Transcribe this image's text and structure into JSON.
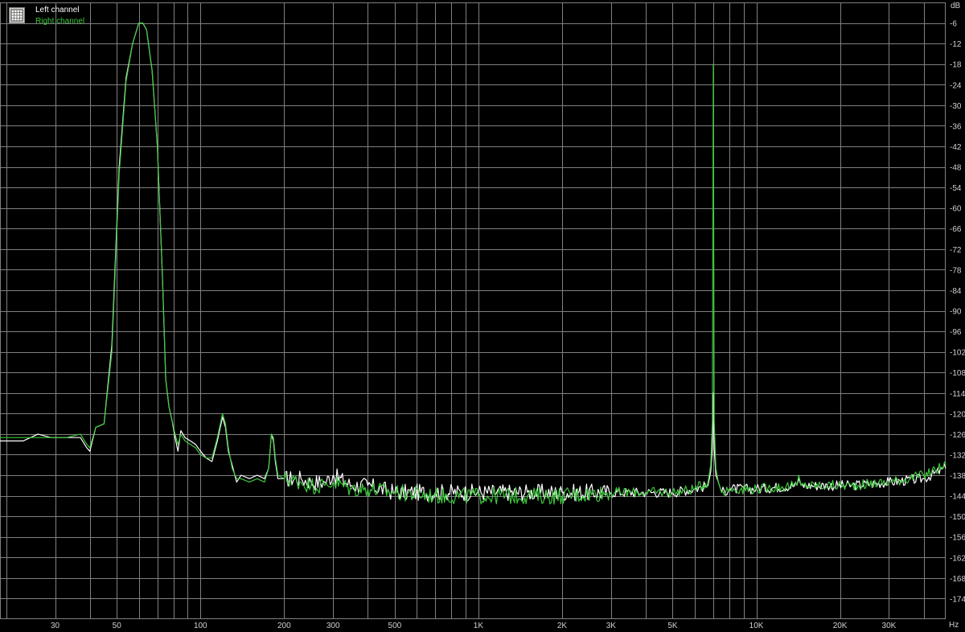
{
  "chart_data": {
    "type": "line",
    "xscale": "log",
    "x_unit": "Hz",
    "y_unit": "dB",
    "xlim": [
      19,
      48000
    ],
    "ylim": [
      -180,
      0
    ],
    "grid": true,
    "background": "#000000",
    "grid_color": "#808080",
    "legend_position": "top-left",
    "x_tick_labels": [
      {
        "value": 30,
        "label": "30"
      },
      {
        "value": 50,
        "label": "50"
      },
      {
        "value": 100,
        "label": "100"
      },
      {
        "value": 200,
        "label": "200"
      },
      {
        "value": 300,
        "label": "300"
      },
      {
        "value": 500,
        "label": "500"
      },
      {
        "value": 1000,
        "label": "1K"
      },
      {
        "value": 2000,
        "label": "2K"
      },
      {
        "value": 3000,
        "label": "3K"
      },
      {
        "value": 5000,
        "label": "5K"
      },
      {
        "value": 10000,
        "label": "10K"
      },
      {
        "value": 20000,
        "label": "20K"
      },
      {
        "value": 30000,
        "label": "30K"
      }
    ],
    "y_ticks": [
      -6,
      -12,
      -18,
      -24,
      -30,
      -36,
      -42,
      -48,
      -54,
      -60,
      -66,
      -72,
      -78,
      -84,
      -90,
      -96,
      -102,
      -108,
      -114,
      -120,
      -126,
      -132,
      -138,
      -144,
      -150,
      -156,
      -162,
      -168,
      -174
    ],
    "series": [
      {
        "name": "Left channel",
        "color": "#ffffff",
        "points": [
          [
            19,
            -128
          ],
          [
            23,
            -128
          ],
          [
            26,
            -126
          ],
          [
            29,
            -127
          ],
          [
            33,
            -127
          ],
          [
            37,
            -127
          ],
          [
            39,
            -130
          ],
          [
            40,
            -131
          ],
          [
            42,
            -124
          ],
          [
            45,
            -123
          ],
          [
            48,
            -100
          ],
          [
            51,
            -48
          ],
          [
            54,
            -22
          ],
          [
            57,
            -12
          ],
          [
            60,
            -6
          ],
          [
            62,
            -6
          ],
          [
            64,
            -8
          ],
          [
            67,
            -20
          ],
          [
            70,
            -42
          ],
          [
            73,
            -80
          ],
          [
            75,
            -110
          ],
          [
            77,
            -118
          ],
          [
            79,
            -122
          ],
          [
            81,
            -127
          ],
          [
            83,
            -131
          ],
          [
            85,
            -125
          ],
          [
            88,
            -127
          ],
          [
            92,
            -128
          ],
          [
            96,
            -129
          ],
          [
            100,
            -131
          ],
          [
            105,
            -133
          ],
          [
            110,
            -134
          ],
          [
            115,
            -128
          ],
          [
            120,
            -121
          ],
          [
            123,
            -124
          ],
          [
            126,
            -131
          ],
          [
            130,
            -135
          ],
          [
            135,
            -140
          ],
          [
            140,
            -138
          ],
          [
            150,
            -139
          ],
          [
            160,
            -138
          ],
          [
            170,
            -139
          ],
          [
            176,
            -136
          ],
          [
            180,
            -126
          ],
          [
            183,
            -128
          ],
          [
            186,
            -134
          ],
          [
            190,
            -139
          ],
          [
            200,
            -139
          ],
          [
            230,
            -139
          ],
          [
            250,
            -140
          ],
          [
            280,
            -140
          ],
          [
            300,
            -138
          ],
          [
            350,
            -141
          ],
          [
            400,
            -141
          ],
          [
            500,
            -143
          ],
          [
            700,
            -143
          ],
          [
            1000,
            -143
          ],
          [
            1500,
            -143
          ],
          [
            2000,
            -143
          ],
          [
            3000,
            -143
          ],
          [
            4000,
            -143
          ],
          [
            5000,
            -143
          ],
          [
            6000,
            -142
          ],
          [
            6700,
            -141
          ],
          [
            6850,
            -137
          ],
          [
            6950,
            -130
          ],
          [
            7000,
            -114
          ],
          [
            7050,
            -130
          ],
          [
            7150,
            -138
          ],
          [
            7300,
            -140
          ],
          [
            7500,
            -143
          ],
          [
            8000,
            -142
          ],
          [
            10000,
            -142
          ],
          [
            14000,
            -141
          ],
          [
            14200,
            -139
          ],
          [
            14500,
            -141
          ],
          [
            18000,
            -141
          ],
          [
            22000,
            -141
          ],
          [
            30000,
            -140
          ],
          [
            40000,
            -139
          ],
          [
            48000,
            -136
          ]
        ]
      },
      {
        "name": "Right channel",
        "color": "#3cc83c",
        "points": [
          [
            19,
            -127
          ],
          [
            23,
            -127
          ],
          [
            26,
            -127
          ],
          [
            29,
            -127
          ],
          [
            33,
            -127
          ],
          [
            37,
            -126
          ],
          [
            39,
            -129
          ],
          [
            40,
            -130
          ],
          [
            42,
            -124
          ],
          [
            45,
            -123
          ],
          [
            48,
            -102
          ],
          [
            51,
            -50
          ],
          [
            54,
            -23
          ],
          [
            57,
            -12
          ],
          [
            60,
            -6
          ],
          [
            62,
            -6
          ],
          [
            64,
            -8
          ],
          [
            67,
            -20
          ],
          [
            70,
            -42
          ],
          [
            73,
            -80
          ],
          [
            75,
            -110
          ],
          [
            77,
            -118
          ],
          [
            79,
            -122
          ],
          [
            81,
            -126
          ],
          [
            83,
            -129
          ],
          [
            85,
            -126
          ],
          [
            88,
            -128
          ],
          [
            92,
            -129
          ],
          [
            96,
            -130
          ],
          [
            100,
            -132
          ],
          [
            105,
            -133
          ],
          [
            110,
            -133
          ],
          [
            115,
            -127
          ],
          [
            120,
            -120
          ],
          [
            123,
            -123
          ],
          [
            126,
            -130
          ],
          [
            130,
            -136
          ],
          [
            135,
            -139
          ],
          [
            140,
            -139
          ],
          [
            150,
            -140
          ],
          [
            160,
            -139
          ],
          [
            170,
            -140
          ],
          [
            176,
            -136
          ],
          [
            180,
            -126
          ],
          [
            183,
            -127
          ],
          [
            186,
            -133
          ],
          [
            190,
            -138
          ],
          [
            200,
            -139
          ],
          [
            230,
            -140
          ],
          [
            250,
            -141
          ],
          [
            280,
            -141
          ],
          [
            300,
            -140
          ],
          [
            350,
            -142
          ],
          [
            400,
            -142
          ],
          [
            500,
            -143
          ],
          [
            700,
            -144
          ],
          [
            1000,
            -144
          ],
          [
            1500,
            -144
          ],
          [
            2000,
            -144
          ],
          [
            3000,
            -143
          ],
          [
            4000,
            -143
          ],
          [
            5000,
            -143
          ],
          [
            6000,
            -142
          ],
          [
            6700,
            -140
          ],
          [
            6850,
            -135
          ],
          [
            6950,
            -122
          ],
          [
            7000,
            -18
          ],
          [
            7050,
            -122
          ],
          [
            7150,
            -136
          ],
          [
            7300,
            -140
          ],
          [
            7500,
            -143
          ],
          [
            8000,
            -142
          ],
          [
            10000,
            -142
          ],
          [
            14000,
            -141
          ],
          [
            14200,
            -138
          ],
          [
            14500,
            -141
          ],
          [
            18000,
            -141
          ],
          [
            22000,
            -141
          ],
          [
            30000,
            -140
          ],
          [
            40000,
            -138
          ],
          [
            48000,
            -135
          ]
        ]
      }
    ]
  },
  "legend": {
    "icon": "grid-icon",
    "items": [
      {
        "label": "Left channel",
        "color": "#ffffff"
      },
      {
        "label": "Right channel",
        "color": "#3cc83c"
      }
    ]
  },
  "axes": {
    "y_unit_label": "dB",
    "x_unit_label": "Hz"
  }
}
